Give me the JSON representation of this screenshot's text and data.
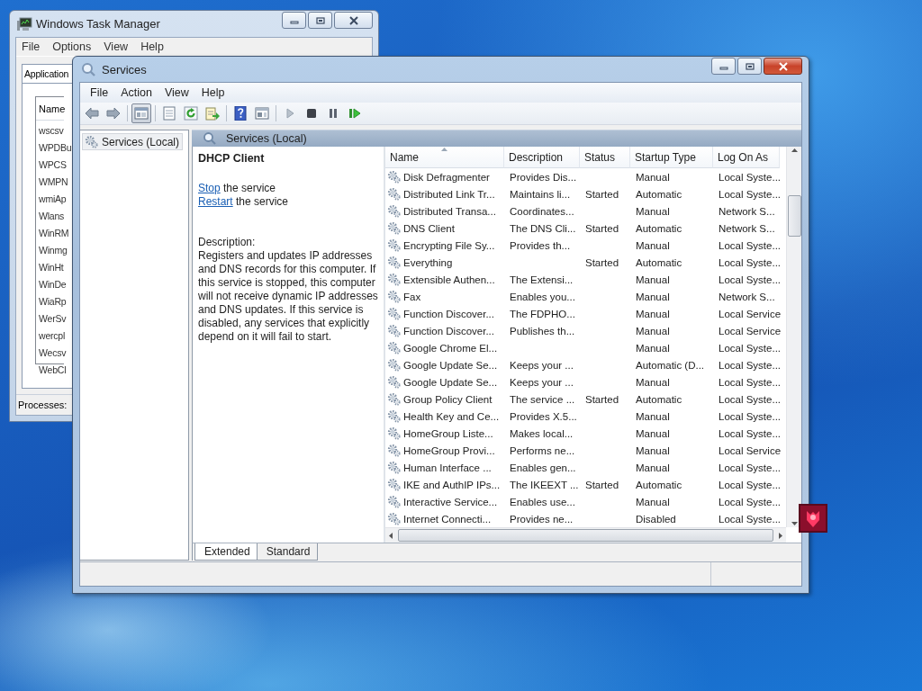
{
  "task_manager": {
    "title": "Windows Task Manager",
    "menu": [
      "File",
      "Options",
      "View",
      "Help"
    ],
    "tab": "Application",
    "column": "Name",
    "processes": [
      "wscsv",
      "WPDBu",
      "WPCS",
      "WMPN",
      "wmiAp",
      "Wlans",
      "WinRM",
      "Winmg",
      "WinHt",
      "WinDe",
      "WiaRp",
      "WerSv",
      "wercpl",
      "Wecsv",
      "WebCl"
    ],
    "status": "Processes:"
  },
  "services": {
    "title": "Services",
    "menu": [
      "File",
      "Action",
      "View",
      "Help"
    ],
    "tree": [
      {
        "label": "Services (Local)",
        "selected": true
      }
    ],
    "header": "Services (Local)",
    "detail": {
      "service": "DHCP Client",
      "actions": [
        {
          "link": "Stop",
          "text": "the service"
        },
        {
          "link": "Restart",
          "text": "the service"
        }
      ],
      "description_label": "Description:",
      "description": "Registers and updates IP addresses and DNS records for this computer. If this service is stopped, this computer will not receive dynamic IP addresses and DNS updates. If this service is disabled, any services that explicitly depend on it will fail to start."
    },
    "columns": [
      {
        "label": "Name",
        "sorted": true
      },
      {
        "label": "Description",
        "sorted": false
      },
      {
        "label": "Status",
        "sorted": false
      },
      {
        "label": "Startup Type",
        "sorted": false
      },
      {
        "label": "Log On As",
        "sorted": false
      }
    ],
    "rows": [
      {
        "name": "Disk Defragmenter",
        "description": "Provides Dis...",
        "startup_type": "Manual",
        "log_on_as": "Local Syste..."
      },
      {
        "name": "Distributed Link Tr...",
        "description": "Maintains li...",
        "status": "Started",
        "startup_type": "Automatic",
        "log_on_as": "Local Syste..."
      },
      {
        "name": "Distributed Transa...",
        "description": "Coordinates...",
        "startup_type": "Manual",
        "log_on_as": "Network S..."
      },
      {
        "name": "DNS Client",
        "description": "The DNS Cli...",
        "status": "Started",
        "startup_type": "Automatic",
        "log_on_as": "Network S..."
      },
      {
        "name": "Encrypting File Sy...",
        "description": "Provides th...",
        "startup_type": "Manual",
        "log_on_as": "Local Syste..."
      },
      {
        "name": "Everything",
        "status": "Started",
        "startup_type": "Automatic",
        "log_on_as": "Local Syste..."
      },
      {
        "name": "Extensible Authen...",
        "description": "The Extensi...",
        "startup_type": "Manual",
        "log_on_as": "Local Syste..."
      },
      {
        "name": "Fax",
        "description": "Enables you...",
        "startup_type": "Manual",
        "log_on_as": "Network S..."
      },
      {
        "name": "Function Discover...",
        "description": "The FDPHO...",
        "startup_type": "Manual",
        "log_on_as": "Local Service"
      },
      {
        "name": "Function Discover...",
        "description": "Publishes th...",
        "startup_type": "Manual",
        "log_on_as": "Local Service"
      },
      {
        "name": "Google Chrome El...",
        "startup_type": "Manual",
        "log_on_as": "Local Syste..."
      },
      {
        "name": "Google Update Se...",
        "description": "Keeps your ...",
        "startup_type": "Automatic (D...",
        "log_on_as": "Local Syste..."
      },
      {
        "name": "Google Update Se...",
        "description": "Keeps your ...",
        "startup_type": "Manual",
        "log_on_as": "Local Syste..."
      },
      {
        "name": "Group Policy Client",
        "description": "The service ...",
        "status": "Started",
        "startup_type": "Automatic",
        "log_on_as": "Local Syste..."
      },
      {
        "name": "Health Key and Ce...",
        "description": "Provides X.5...",
        "startup_type": "Manual",
        "log_on_as": "Local Syste..."
      },
      {
        "name": "HomeGroup Liste...",
        "description": "Makes local...",
        "startup_type": "Manual",
        "log_on_as": "Local Syste..."
      },
      {
        "name": "HomeGroup Provi...",
        "description": "Performs ne...",
        "startup_type": "Manual",
        "log_on_as": "Local Service"
      },
      {
        "name": "Human Interface ...",
        "description": "Enables gen...",
        "startup_type": "Manual",
        "log_on_as": "Local Syste..."
      },
      {
        "name": "IKE and AuthIP IPs...",
        "description": "The IKEEXT ...",
        "status": "Started",
        "startup_type": "Automatic",
        "log_on_as": "Local Syste..."
      },
      {
        "name": "Interactive Service...",
        "description": "Enables use...",
        "startup_type": "Manual",
        "log_on_as": "Local Syste..."
      },
      {
        "name": "Internet Connecti...",
        "description": "Provides ne...",
        "startup_type": "Disabled",
        "log_on_as": "Local Syste..."
      }
    ],
    "tabs": [
      {
        "label": "Extended",
        "selected": true
      },
      {
        "label": "Standard",
        "selected": false
      }
    ]
  }
}
